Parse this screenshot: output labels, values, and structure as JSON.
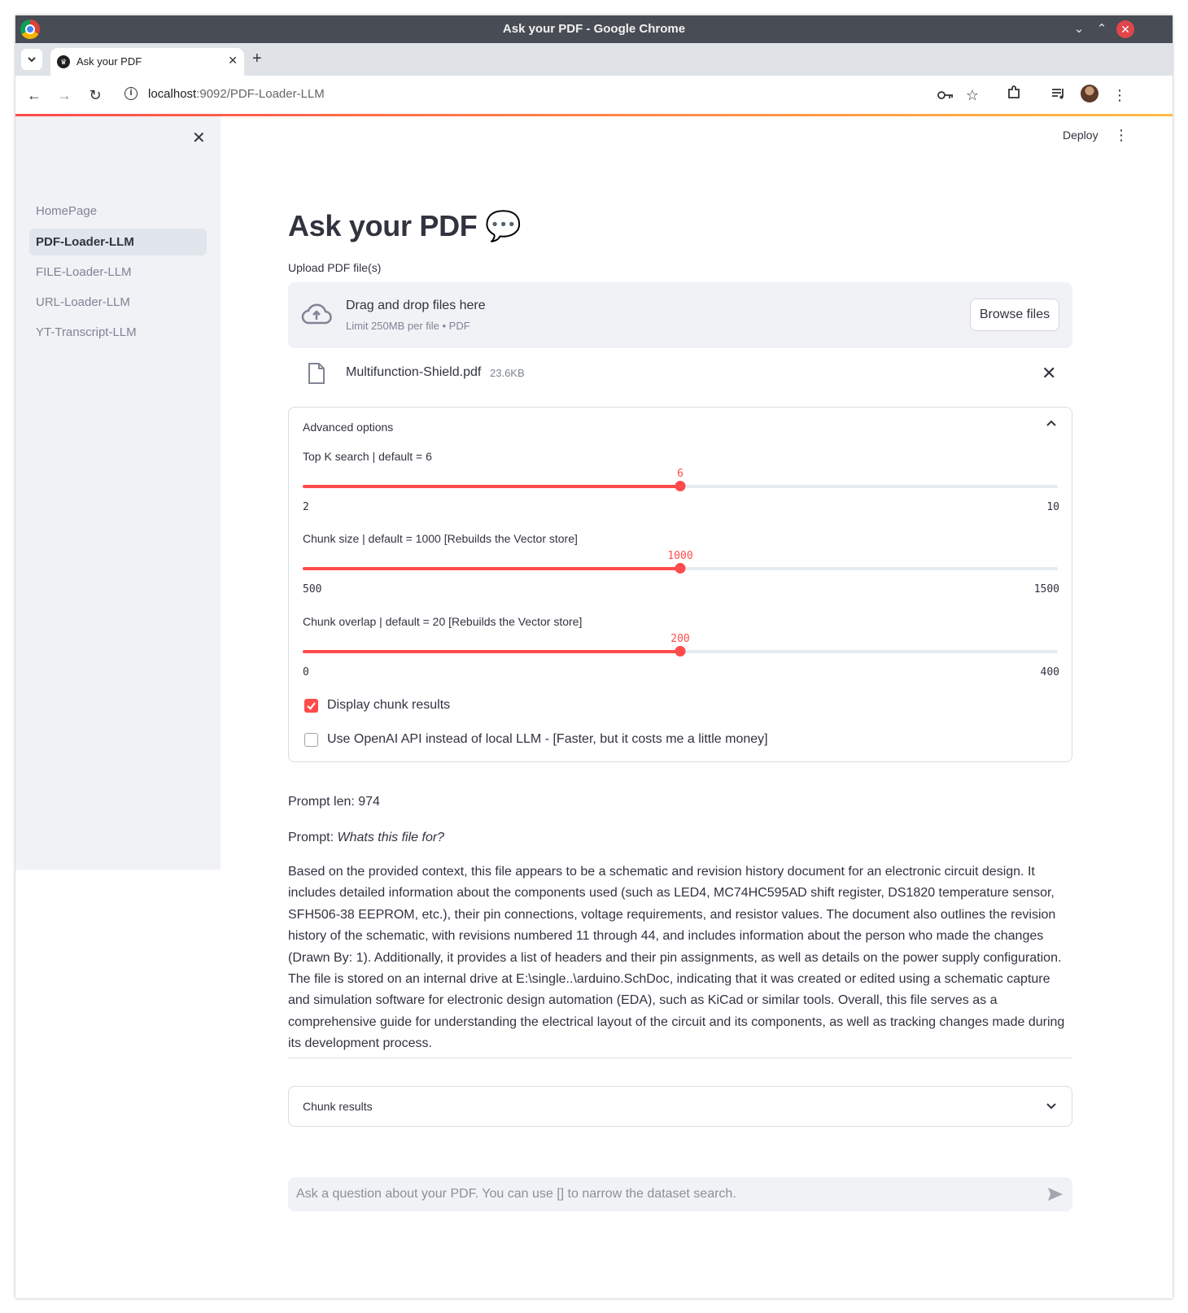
{
  "window": {
    "title": "Ask your PDF - Google Chrome",
    "tab_list_icon": "chevron-down-icon",
    "tab_title": "Ask your PDF",
    "tab_close": "✕",
    "new_tab": "+"
  },
  "toolbar": {
    "url_host": "localhost",
    "url_path": ":9092/PDF-Loader-LLM"
  },
  "header": {
    "deploy_label": "Deploy",
    "menu_icon": "⋮"
  },
  "sidebar": {
    "close_icon": "✕",
    "items": [
      {
        "label": "HomePage",
        "active": false
      },
      {
        "label": "PDF-Loader-LLM",
        "active": true
      },
      {
        "label": "FILE-Loader-LLM",
        "active": false
      },
      {
        "label": "URL-Loader-LLM",
        "active": false
      },
      {
        "label": "YT-Transcript-LLM",
        "active": false
      }
    ]
  },
  "main": {
    "title": "Ask your PDF",
    "title_emoji": "💬",
    "upload_label": "Upload PDF file(s)",
    "dropzone_title": "Drag and drop files here",
    "dropzone_sub": "Limit 250MB per file • PDF",
    "browse_label": "Browse files",
    "file": {
      "name": "Multifunction-Shield.pdf",
      "size": "23.6KB",
      "remove": "✕"
    },
    "advanced": {
      "label": "Advanced options",
      "expanded": true,
      "sliders": [
        {
          "label": "Top K search | default = 6",
          "value": "6",
          "min": "2",
          "max": "10",
          "fraction": 0.5
        },
        {
          "label": "Chunk size | default = 1000 [Rebuilds the Vector store]",
          "value": "1000",
          "min": "500",
          "max": "1500",
          "fraction": 0.5
        },
        {
          "label": "Chunk overlap | default = 20 [Rebuilds the Vector store]",
          "value": "200",
          "min": "0",
          "max": "400",
          "fraction": 0.5
        }
      ],
      "checkboxes": [
        {
          "label": "Display chunk results",
          "checked": true
        },
        {
          "label": "Use OpenAI API instead of local LLM - [Faster, but it costs me a little money]",
          "checked": false
        }
      ]
    },
    "prompt_len": "Prompt len: 974",
    "prompt_prefix": "Prompt: ",
    "prompt_text": "Whats this file for?",
    "answer": "Based on the provided context, this file appears to be a schematic and revision history document for an electronic circuit design. It includes detailed information about the components used (such as LED4, MC74HC595AD shift register, DS1820 temperature sensor, SFH506-38 EEPROM, etc.), their pin connections, voltage requirements, and resistor values. The document also outlines the revision history of the schematic, with revisions numbered 11 through 44, and includes information about the person who made the changes (Drawn By: 1). Additionally, it provides a list of headers and their pin assignments, as well as details on the power supply configuration. The file is stored on an internal drive at E:\\single..\\arduino.SchDoc, indicating that it was created or edited using a schematic capture and simulation software for electronic design automation (EDA), such as KiCad or similar tools. Overall, this file serves as a comprehensive guide for understanding the electrical layout of the circuit and its components, as well as tracking changes made during its development process.",
    "chunk_results_label": "Chunk results",
    "chat_placeholder": "Ask a question about your PDF. You can use [] to narrow the dataset search."
  },
  "colors": {
    "accent": "#ff4b4b",
    "sidebar_bg": "#f0f2f6",
    "text": "#31333f",
    "muted": "#808495"
  }
}
